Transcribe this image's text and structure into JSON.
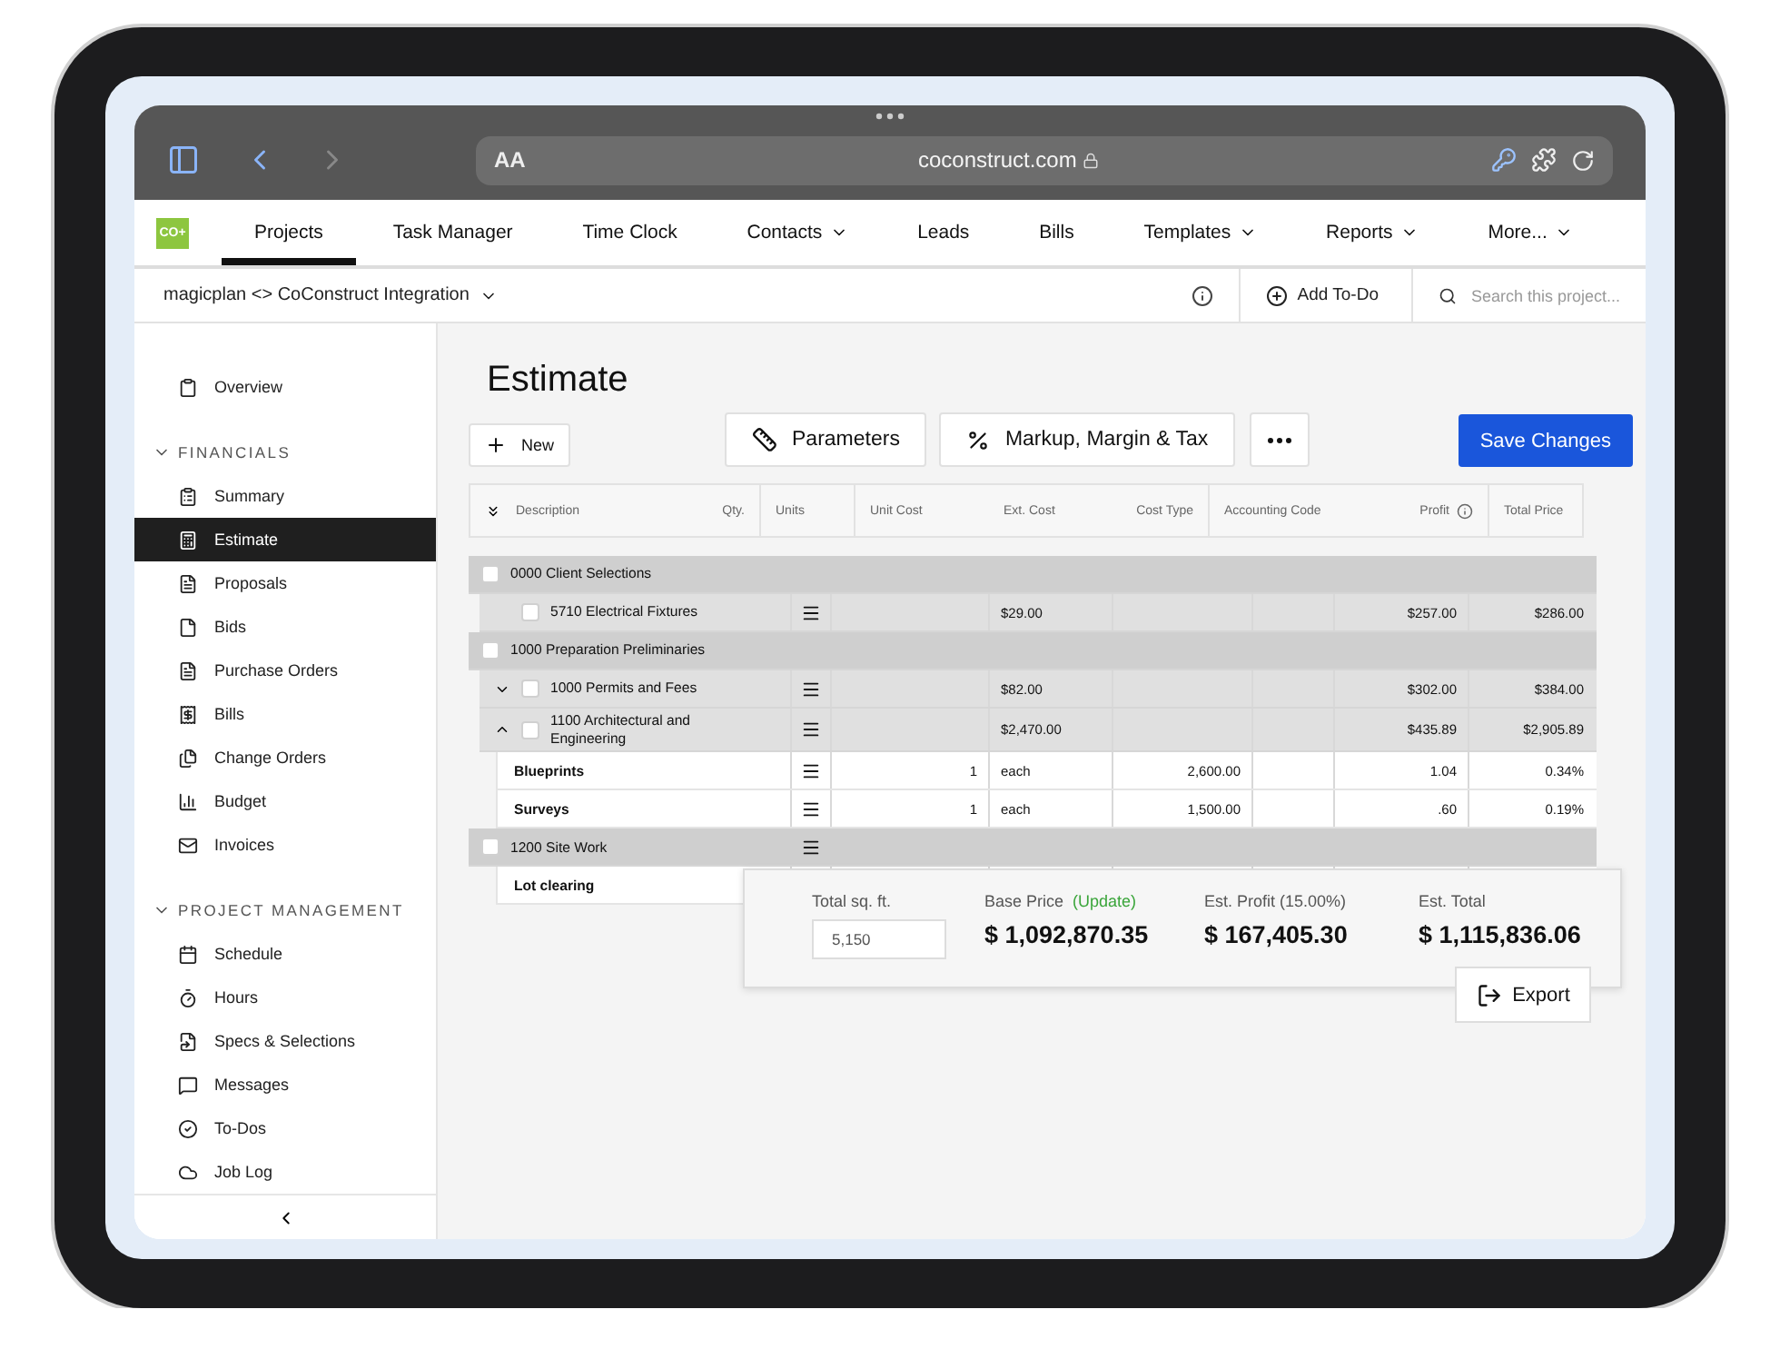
{
  "browser": {
    "text_size": "AA",
    "url": "coconstruct.com"
  },
  "logo": "CO+",
  "nav_tabs": [
    {
      "label": "Projects",
      "selected": true,
      "dropdown": false
    },
    {
      "label": "Task Manager",
      "selected": false,
      "dropdown": false
    },
    {
      "label": "Time Clock",
      "selected": false,
      "dropdown": false
    },
    {
      "label": "Contacts",
      "selected": false,
      "dropdown": true
    },
    {
      "label": "Leads",
      "selected": false,
      "dropdown": false
    },
    {
      "label": "Bills",
      "selected": false,
      "dropdown": false
    },
    {
      "label": "Templates",
      "selected": false,
      "dropdown": true
    },
    {
      "label": "Reports",
      "selected": false,
      "dropdown": true
    },
    {
      "label": "More...",
      "selected": false,
      "dropdown": true
    }
  ],
  "project_bar": {
    "project": "magicplan <> CoConstruct Integration",
    "add_todo": "Add To-Do",
    "search": {
      "placeholder": "Search this project..."
    }
  },
  "sidebar": {
    "top_items": [
      {
        "label": "Overview",
        "selected": false
      }
    ],
    "sections": [
      {
        "title": "FINANCIALS",
        "expanded": true,
        "items": [
          {
            "label": "Summary",
            "selected": false
          },
          {
            "label": "Estimate",
            "selected": true
          },
          {
            "label": "Proposals",
            "selected": false
          },
          {
            "label": "Bids",
            "selected": false
          },
          {
            "label": "Purchase Orders",
            "selected": false
          },
          {
            "label": "Bills",
            "selected": false
          },
          {
            "label": "Change Orders",
            "selected": false
          },
          {
            "label": "Budget",
            "selected": false
          },
          {
            "label": "Invoices",
            "selected": false
          }
        ]
      },
      {
        "title": "PROJECT MANAGEMENT",
        "expanded": true,
        "items": [
          {
            "label": "Schedule",
            "selected": false
          },
          {
            "label": "Hours",
            "selected": false
          },
          {
            "label": "Specs & Selections",
            "selected": false
          },
          {
            "label": "Messages",
            "selected": false
          },
          {
            "label": "To-Dos",
            "selected": false
          },
          {
            "label": "Job Log",
            "selected": false
          }
        ]
      }
    ]
  },
  "page_title": "Estimate",
  "toolbar": {
    "new": "New",
    "parameters": "Parameters",
    "markup": "Markup, Margin & Tax",
    "save": "Save Changes"
  },
  "table": {
    "header_cells": [
      {
        "labels": [
          "Description",
          "Qty."
        ]
      },
      {
        "labels": [
          "Units"
        ]
      },
      {
        "labels": [
          "Unit Cost",
          "Ext. Cost",
          "Cost Type"
        ]
      },
      {
        "labels": [
          "Accounting Code",
          "Profit"
        ],
        "info": true
      },
      {
        "labels": [
          "Total Price"
        ]
      }
    ],
    "rows": [
      {
        "kind": "group",
        "checked": false,
        "description": "0000 Client Selections",
        "menu": false
      },
      {
        "kind": "item",
        "checked": false,
        "description": "5710 Electrical Fixtures",
        "menu": true,
        "column_4": "$29.00",
        "column_7": "$257.00",
        "column_8": "$286.00"
      },
      {
        "kind": "group",
        "checked": false,
        "description": "1000 Preparation Preliminaries",
        "menu": false
      },
      {
        "kind": "item",
        "checked": false,
        "expanded": false,
        "description": "1000 Permits and Fees",
        "menu": true,
        "column_4": "$82.00",
        "column_7": "$302.00",
        "column_8": "$384.00"
      },
      {
        "kind": "item",
        "checked": false,
        "expanded": true,
        "description": "1100 Architectural and Engineering",
        "menu": true,
        "column_4": "$2,470.00",
        "column_7": "$435.89",
        "column_8": "$2,905.89"
      },
      {
        "kind": "detail",
        "description": "Blueprints",
        "menu": true,
        "column_3": "1",
        "column_4": "each",
        "column_5": "2,600.00",
        "column_7": "1.04",
        "column_8": "0.34%"
      },
      {
        "kind": "detail",
        "description": "Surveys",
        "menu": true,
        "column_3": "1",
        "column_4": "each",
        "column_5": "1,500.00",
        "column_7": ".60",
        "column_8": "0.19%"
      },
      {
        "kind": "group",
        "checked": false,
        "description": "1200 Site Work",
        "menu": true
      },
      {
        "kind": "detail",
        "description": "Lot clearing"
      }
    ]
  },
  "summary": {
    "sqft_label": "Total sq. ft.",
    "sqft_value": "5,150",
    "base_label": "Base Price",
    "update_link": "(Update)",
    "base_value": "$ 1,092,870.35",
    "profit_label": "Est. Profit (15.00%)",
    "profit_value": "$ 167,405.30",
    "total_label": "Est. Total",
    "total_value": "$ 1,115,836.06",
    "export": "Export"
  }
}
